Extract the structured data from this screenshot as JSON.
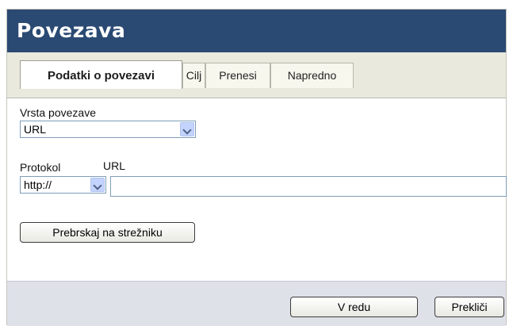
{
  "dialog": {
    "title": "Povezava"
  },
  "tabs": [
    {
      "label": "Podatki o povezavi",
      "active": true
    },
    {
      "label": "Cilj",
      "active": false
    },
    {
      "label": "Prenesi",
      "active": false
    },
    {
      "label": "Napredno",
      "active": false
    }
  ],
  "link_info": {
    "link_type_label": "Vrsta povezave",
    "link_type_value": "URL",
    "protocol_label": "Protokol",
    "protocol_value": "http://",
    "url_label": "URL",
    "url_value": "",
    "browse_button": "Prebrskaj na strežniku"
  },
  "footer": {
    "ok_button": "V redu",
    "cancel_button": "Prekliči"
  },
  "colors": {
    "title_bar": "#2b4a73",
    "dialog_bg": "#f1f1e3",
    "footer_bg": "#dfe1e9"
  }
}
